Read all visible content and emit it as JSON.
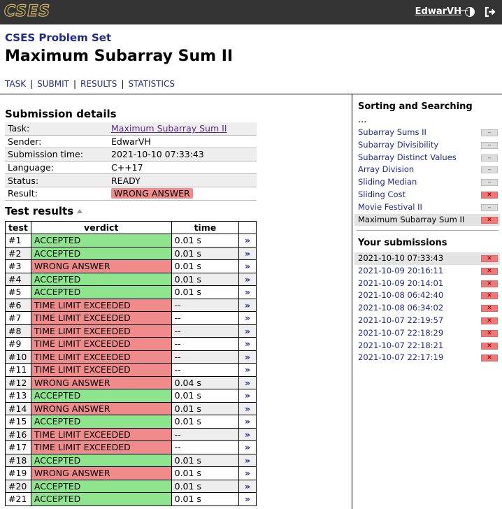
{
  "header": {
    "logo": "CSES",
    "user": "EdwarVH",
    "dash": "—"
  },
  "problem_set": "CSES Problem Set",
  "title": "Maximum Subarray Sum II",
  "nav": [
    "TASK",
    "SUBMIT",
    "RESULTS",
    "STATISTICS"
  ],
  "details": {
    "heading": "Submission details",
    "rows": [
      {
        "k": "Task:",
        "v": "Maximum Subarray Sum II"
      },
      {
        "k": "Sender:",
        "v": "EdwarVH"
      },
      {
        "k": "Submission time:",
        "v": "2021-10-10 07:33:43"
      },
      {
        "k": "Language:",
        "v": "C++17"
      },
      {
        "k": "Status:",
        "v": "READY"
      },
      {
        "k": "Result:",
        "v": "WRONG ANSWER"
      }
    ]
  },
  "tests": {
    "heading": "Test results",
    "columns": [
      "test",
      "verdict",
      "time",
      ""
    ],
    "view_symbol": "»",
    "rows": [
      {
        "n": "#1",
        "verdict": "ACCEPTED",
        "time": "0.01 s"
      },
      {
        "n": "#2",
        "verdict": "ACCEPTED",
        "time": "0.01 s"
      },
      {
        "n": "#3",
        "verdict": "WRONG ANSWER",
        "time": "0.01 s"
      },
      {
        "n": "#4",
        "verdict": "ACCEPTED",
        "time": "0.01 s"
      },
      {
        "n": "#5",
        "verdict": "ACCEPTED",
        "time": "0.01 s"
      },
      {
        "n": "#6",
        "verdict": "TIME LIMIT EXCEEDED",
        "time": "--"
      },
      {
        "n": "#7",
        "verdict": "TIME LIMIT EXCEEDED",
        "time": "--"
      },
      {
        "n": "#8",
        "verdict": "TIME LIMIT EXCEEDED",
        "time": "--"
      },
      {
        "n": "#9",
        "verdict": "TIME LIMIT EXCEEDED",
        "time": "--"
      },
      {
        "n": "#10",
        "verdict": "TIME LIMIT EXCEEDED",
        "time": "--"
      },
      {
        "n": "#11",
        "verdict": "TIME LIMIT EXCEEDED",
        "time": "--"
      },
      {
        "n": "#12",
        "verdict": "WRONG ANSWER",
        "time": "0.04 s"
      },
      {
        "n": "#13",
        "verdict": "ACCEPTED",
        "time": "0.01 s"
      },
      {
        "n": "#14",
        "verdict": "WRONG ANSWER",
        "time": "0.01 s"
      },
      {
        "n": "#15",
        "verdict": "ACCEPTED",
        "time": "0.01 s"
      },
      {
        "n": "#16",
        "verdict": "TIME LIMIT EXCEEDED",
        "time": "--"
      },
      {
        "n": "#17",
        "verdict": "TIME LIMIT EXCEEDED",
        "time": "--"
      },
      {
        "n": "#18",
        "verdict": "ACCEPTED",
        "time": "0.01 s"
      },
      {
        "n": "#19",
        "verdict": "WRONG ANSWER",
        "time": "0.01 s"
      },
      {
        "n": "#20",
        "verdict": "ACCEPTED",
        "time": "0.01 s"
      },
      {
        "n": "#21",
        "verdict": "ACCEPTED",
        "time": "0.01 s"
      }
    ]
  },
  "sidebar": {
    "section_title": "Sorting and Searching",
    "ellipsis": "...",
    "problems": [
      {
        "name": "Subarray Sums II",
        "status": "none",
        "mark": "–"
      },
      {
        "name": "Subarray Divisibility",
        "status": "none",
        "mark": "–"
      },
      {
        "name": "Subarray Distinct Values",
        "status": "none",
        "mark": "–"
      },
      {
        "name": "Array Division",
        "status": "none",
        "mark": "–"
      },
      {
        "name": "Sliding Median",
        "status": "none",
        "mark": "–"
      },
      {
        "name": "Sliding Cost",
        "status": "fail",
        "mark": "✕"
      },
      {
        "name": "Movie Festival II",
        "status": "none",
        "mark": "–"
      },
      {
        "name": "Maximum Subarray Sum II",
        "status": "fail",
        "mark": "✕",
        "current": true
      }
    ],
    "submissions_title": "Your submissions",
    "submissions": [
      {
        "time": "2021-10-10 07:33:43",
        "mark": "✕",
        "current": true
      },
      {
        "time": "2021-10-09 20:16:11",
        "mark": "✕"
      },
      {
        "time": "2021-10-09 20:14:01",
        "mark": "✕"
      },
      {
        "time": "2021-10-08 06:42:40",
        "mark": "✕"
      },
      {
        "time": "2021-10-08 06:34:02",
        "mark": "✕"
      },
      {
        "time": "2021-10-07 22:19:57",
        "mark": "✕"
      },
      {
        "time": "2021-10-07 22:18:29",
        "mark": "✕"
      },
      {
        "time": "2021-10-07 22:18:21",
        "mark": "✕"
      },
      {
        "time": "2021-10-07 22:17:19",
        "mark": "✕"
      }
    ]
  },
  "colors": {
    "accepted": "#8ee58e",
    "rejected": "#f08b8b",
    "header_bg": "#333333",
    "link": "#1f2a8f"
  }
}
